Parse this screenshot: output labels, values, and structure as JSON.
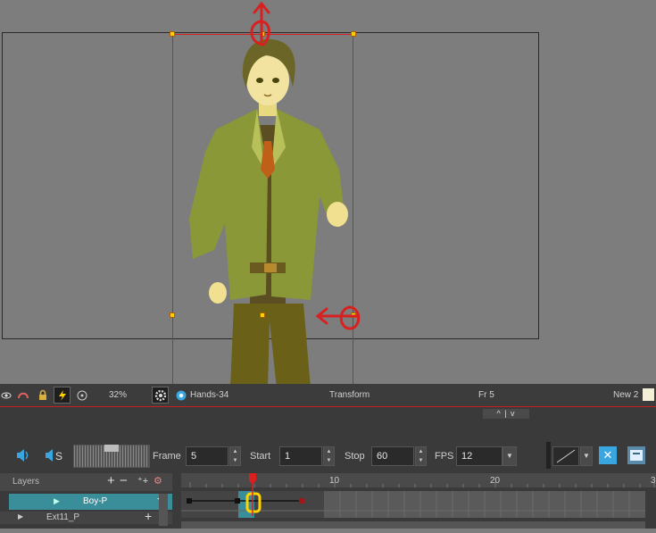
{
  "status_bar": {
    "zoom": "32%",
    "drawing_name": "Hands-34",
    "mode": "Transform",
    "frame_readout": "Fr 5",
    "new_label": "New 2"
  },
  "playback": {
    "frame_label": "Frame",
    "frame_value": "5",
    "start_label": "Start",
    "start_value": "1",
    "stop_label": "Stop",
    "stop_value": "60",
    "fps_label": "FPS",
    "fps_value": "12",
    "sound_label": "S"
  },
  "timeline": {
    "layers_label": "Layers",
    "layers": [
      {
        "name": "Boy-P",
        "selected": true
      },
      {
        "name": "Ext11_P",
        "selected": false
      }
    ],
    "ruler_ticks": [
      "10",
      "20",
      "3"
    ],
    "current_frame": 5
  },
  "colors": {
    "accent": "#3a8e9a",
    "annotation": "#d82020",
    "highlight": "#ffd200"
  },
  "icons": [
    "eye-icon",
    "onion-skin-icon",
    "lock-icon",
    "lightning-icon",
    "rotate-view-icon",
    "gear-icon",
    "flower-icon",
    "speaker-icon",
    "add-icon",
    "remove-icon"
  ]
}
